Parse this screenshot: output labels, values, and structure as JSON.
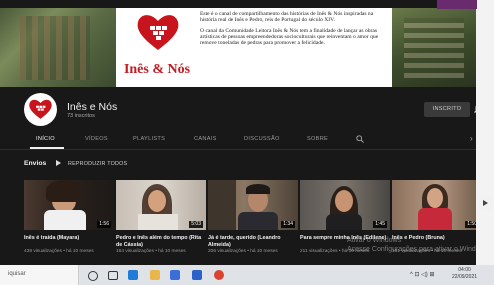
{
  "banner": {
    "logo_text": "Inês & Nós",
    "paragraph1": "Este é o canal de compartilhamento das histórias de Inês & Nós inspiradas na história real de Inês e Pedro, reis de Portugal do século XIV.",
    "paragraph2": "O canal da Comunidade Leitora Inês & Nós tem a finalidade de lançar as obras artísticas de pessoas empreendedoras socioculturais que reinventam o amor que remove toneladas de pedras para promover a felicidade."
  },
  "channel": {
    "name": "Inês e Nós",
    "subscribers": "73 inscritos",
    "subscribe_label": "INSCRITO"
  },
  "tabs": [
    {
      "label": "INÍCIO",
      "active": true
    },
    {
      "label": "VÍDEOS"
    },
    {
      "label": "PLAYLISTS"
    },
    {
      "label": "CANAIS"
    },
    {
      "label": "DISCUSSÃO"
    },
    {
      "label": "SOBRE"
    }
  ],
  "section": {
    "title": "Envios",
    "play_all": "REPRODUZIR TODOS"
  },
  "videos": [
    {
      "title": "Inês é traída (Mayara)",
      "meta": "438 visualizações • há 10 meses",
      "duration": "1:56"
    },
    {
      "title": "Pedro e Inês além do tempo (Rita de Cássia)",
      "meta": "164 visualizações • há 10 meses",
      "duration": "5:03"
    },
    {
      "title": "Já é tarde, querido (Leandro Almeida)",
      "meta": "206 visualizações • há 10 meses",
      "duration": "1:34"
    },
    {
      "title": "Para sempre minha Inês (Edilene)",
      "meta": "211 visualizações • há 10 meses",
      "duration": "1:45"
    },
    {
      "title": "Inês e Pedro (Bruna)",
      "meta": "151 visualizações • há 10 meses",
      "duration": "1:50"
    }
  ],
  "watermark": {
    "line1": "Ativar o Windows",
    "line2": "Acesse Configurações para ativar o Windows."
  },
  "taskbar": {
    "search_placeholder": "iquisar",
    "time": "04:00",
    "date": "22/09/2021"
  }
}
